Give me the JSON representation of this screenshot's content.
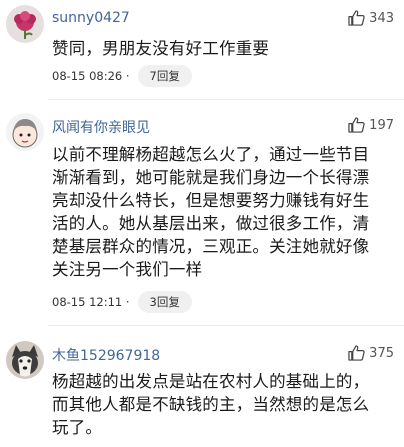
{
  "comments": [
    {
      "avatar_icon": "pink-flower-avatar-icon",
      "username": "sunny0427",
      "likes": "343",
      "text_lines": [
        "赞同，男朋友没有好工作重要"
      ],
      "time": "08-15 08:26 ·",
      "reply_label": "7回复"
    },
    {
      "avatar_icon": "cartoon-face-avatar-icon",
      "username": "风闻有你亲眼见",
      "likes": "197",
      "text_lines": [
        "以前不理解杨超越怎么火了，通过一些节目",
        "渐渐看到，她可能就是我们身边一个长得漂",
        "亮却没什么特长，但是想要努力赚钱有好生",
        "活的人。她从基层出来，做过很多工作，清",
        "楚基层群众的情况，三观正。关注她就好像",
        "关注另一个我们一样"
      ],
      "time": "08-15 12:11 ·",
      "reply_label": "3回复"
    },
    {
      "avatar_icon": "husky-dog-avatar-icon",
      "username": "木鱼152967918",
      "likes": "375",
      "text_lines": [
        "杨超越的出发点是站在农村人的基础上的，",
        "而其他人都是不缺钱的主，当然想的是怎么",
        "玩了。"
      ]
    }
  ]
}
